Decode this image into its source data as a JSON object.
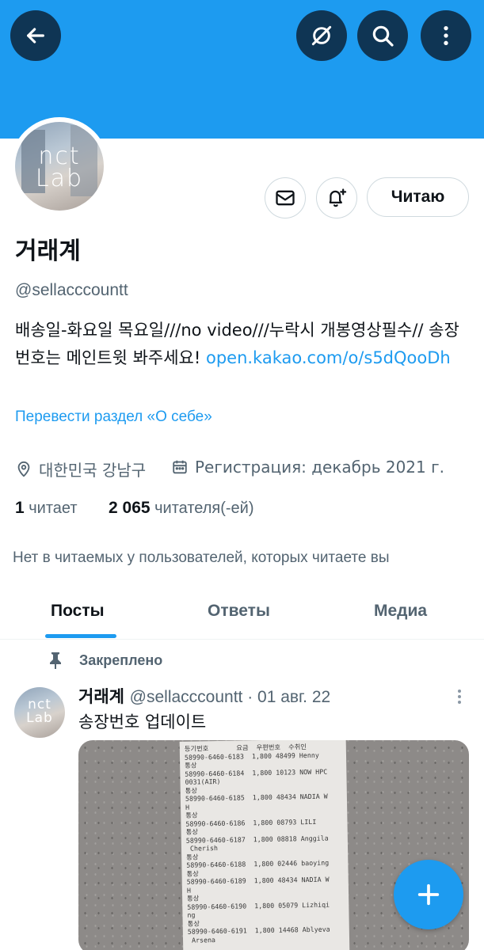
{
  "profile": {
    "display_name": "거래계",
    "handle": "@sellacccountt",
    "bio_text": "배송일-화요일 목요일///no video///누락시 개봉영상필수// 송장번호는 메인트윗 봐주세요! ",
    "bio_link": "open.kakao.com/o/s5dQooDh",
    "translate_label": "Перевести раздел «О себе»",
    "location": "대한민국 강남구",
    "joined": "Регистрация: декабрь 2021 г.",
    "following_count": "1",
    "following_label": "читает",
    "followers_count": "2 065",
    "followers_label": "читателя(-ей)",
    "no_mutuals": "Нет в читаемых у пользователей, которых читаете вы",
    "follow_button": "Читаю",
    "avatar_logo_line1": "nct",
    "avatar_logo_line2": "Lab"
  },
  "tabs": [
    {
      "label": "Посты",
      "active": true
    },
    {
      "label": "Ответы",
      "active": false
    },
    {
      "label": "Медиа",
      "active": false
    }
  ],
  "pinned_post": {
    "pinned_label": "Закреплено",
    "author": "거래계",
    "handle_date": "@sellacccountt · 01 авг. 22",
    "text": "송장번호 업데이트",
    "receipt_lines": "등기번호       요금  우편번호  수취인\n58990-6460-6183  1,800 48499 Henny\n통상\n58990-6460-6184  1,800 10123 NOW HPC\n0031(AIR)\n통상\n58990-6460-6185  1,800 48434 NADIA W\nH\n통상\n58990-6460-6186  1,800 08793 LILI\n통상\n58990-6460-6187  1,800 08818 Anggila\n Cherish\n통상\n58990-6460-6188  1,800 02446 baoying\n통상\n58990-6460-6189  1,800 48434 NADIA W\nH\n통상\n58990-6460-6190  1,800 05079 Lizhiqi\nng\n통상\n58990-6460-6191  1,800 14468 Ablyeva\n Arsena"
  },
  "icons": {
    "back": "arrow-left-icon",
    "hide": "eye-slash-icon",
    "search": "search-icon",
    "more": "more-vertical-icon",
    "message": "envelope-icon",
    "notify": "bell-plus-icon",
    "location": "location-pin-icon",
    "calendar": "calendar-icon",
    "pin": "pin-icon",
    "compose": "plus-icon"
  },
  "colors": {
    "banner": "#1d9bf0",
    "accent": "#1d9bf0",
    "header_buttons": "#0f3554",
    "muted_text": "#536471"
  }
}
